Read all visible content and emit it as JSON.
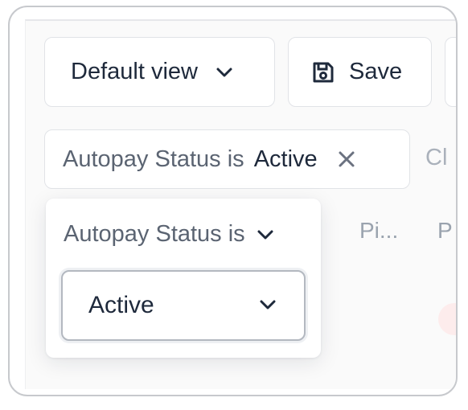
{
  "toolbar": {
    "view_label": "Default view",
    "save_label": "Save"
  },
  "filter_chip": {
    "field": "Autopay Status is",
    "value": "Active"
  },
  "clear_label": "Cl",
  "background_tabs": [
    "Pi...",
    "P"
  ],
  "popover": {
    "header": "Autopay Status is",
    "select_value": "Active"
  },
  "icons": {
    "view_dropdown": "chevron-down-icon",
    "save": "floppy-disk-icon",
    "chip_remove": "close-icon",
    "operator_dropdown": "chevron-down-icon",
    "value_dropdown": "chevron-down-icon"
  },
  "colors": {
    "text_primary": "#1e293b",
    "text_secondary": "#5b6472",
    "border": "#e1e3e7",
    "select_border": "#b3b8c0"
  }
}
